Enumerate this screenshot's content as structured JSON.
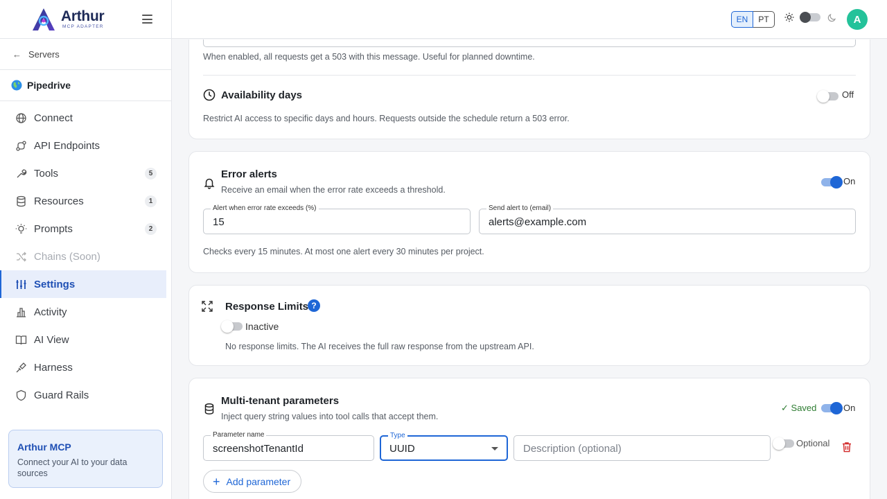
{
  "brand": {
    "name": "Arthur",
    "subtitle": "MCP ADAPTER"
  },
  "sidebar": {
    "back_label": "Servers",
    "server_name": "Pipedrive",
    "items": [
      {
        "label": "Connect",
        "icon": "globe-icon"
      },
      {
        "label": "API Endpoints",
        "icon": "endpoint-icon"
      },
      {
        "label": "Tools",
        "icon": "tool-icon",
        "badge": "5"
      },
      {
        "label": "Resources",
        "icon": "database-icon",
        "badge": "1"
      },
      {
        "label": "Prompts",
        "icon": "bulb-icon",
        "badge": "2"
      },
      {
        "label": "Chains (Soon)",
        "icon": "shuffle-icon",
        "disabled": true
      },
      {
        "label": "Settings",
        "icon": "sliders-icon",
        "active": true
      },
      {
        "label": "Activity",
        "icon": "chart-icon"
      },
      {
        "label": "AI View",
        "icon": "book-icon"
      },
      {
        "label": "Harness",
        "icon": "harness-icon"
      },
      {
        "label": "Guard Rails",
        "icon": "shield-icon"
      }
    ],
    "promo": {
      "title": "Arthur MCP",
      "text": "Connect your AI to your data sources"
    }
  },
  "topbar": {
    "lang_en": "EN",
    "lang_pt": "PT",
    "avatar": "A"
  },
  "colors": {
    "accent": "#1e66d6",
    "avatar": "#24c29a",
    "saved": "#2e7d32",
    "danger": "#d32f2f"
  },
  "maintenance": {
    "help": "When enabled, all requests get a 503 with this message. Useful for planned downtime."
  },
  "availability": {
    "title": "Availability days",
    "desc": "Restrict AI access to specific days and hours. Requests outside the schedule return a 503 error.",
    "state": "Off"
  },
  "error_alerts": {
    "title": "Error alerts",
    "desc": "Receive an email when the error rate exceeds a threshold.",
    "state": "On",
    "threshold_label": "Alert when error rate exceeds (%)",
    "threshold_value": "15",
    "email_label": "Send alert to (email)",
    "email_value": "alerts@example.com",
    "help": "Checks every 15 minutes. At most one alert every 30 minutes per project."
  },
  "response_limits": {
    "title": "Response Limits",
    "state": "Inactive",
    "desc": "No response limits. The AI receives the full raw response from the upstream API."
  },
  "multitenant": {
    "title": "Multi-tenant parameters",
    "desc": "Inject query string values into tool calls that accept them.",
    "saved": "Saved",
    "state": "On",
    "param_name_label": "Parameter name",
    "param_name_value": "screenshotTenantId",
    "type_label": "Type",
    "type_value": "UUID",
    "description_placeholder": "Description (optional)",
    "optional_label": "Optional",
    "add_label": "Add parameter"
  }
}
